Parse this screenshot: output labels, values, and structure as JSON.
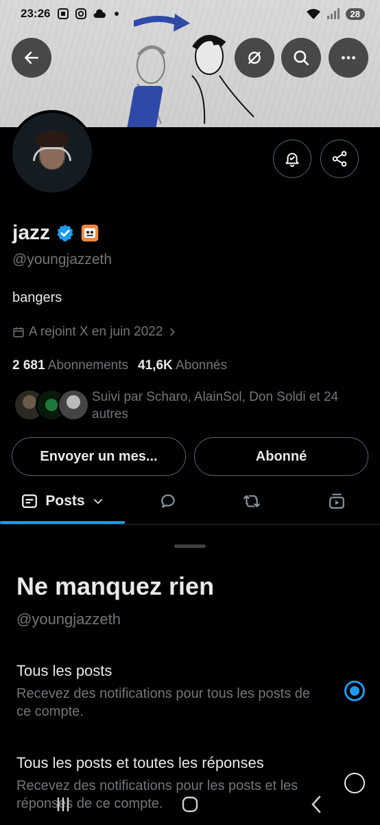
{
  "status_bar": {
    "time": "23:26",
    "battery": "28"
  },
  "banner": {
    "icons": [
      "back-arrow-icon",
      "grok-icon",
      "search-icon",
      "more-icon"
    ]
  },
  "profile": {
    "display_name": "jazz",
    "handle": "@youngjazzeth",
    "bio": "bangers",
    "joined": "A rejoint X en juin 2022",
    "following_count": "2 681",
    "following_label": "Abonnements",
    "followers_count": "41,6K",
    "followers_label": "Abonnés",
    "followed_by": "Suivi par Scharo, AlainSol, Don Soldi et 24 autres"
  },
  "actions": {
    "message_button": "Envoyer un mes...",
    "following_button": "Abonné"
  },
  "tabs": {
    "posts_label": "Posts"
  },
  "sheet": {
    "title": "Ne manquez rien",
    "handle": "@youngjazzeth",
    "options": [
      {
        "title": "Tous les posts",
        "description": "Recevez des notifications pour tous les posts de ce compte.",
        "selected": true
      },
      {
        "title": "Tous les posts et toutes les réponses",
        "description": "Recevez des notifications pour les posts et les réponses de ce compte.",
        "selected": false
      }
    ]
  },
  "colors": {
    "accent": "#1d9bf0",
    "background": "#000000",
    "muted_text": "#71767b",
    "primary_text": "#e7e9ea"
  }
}
